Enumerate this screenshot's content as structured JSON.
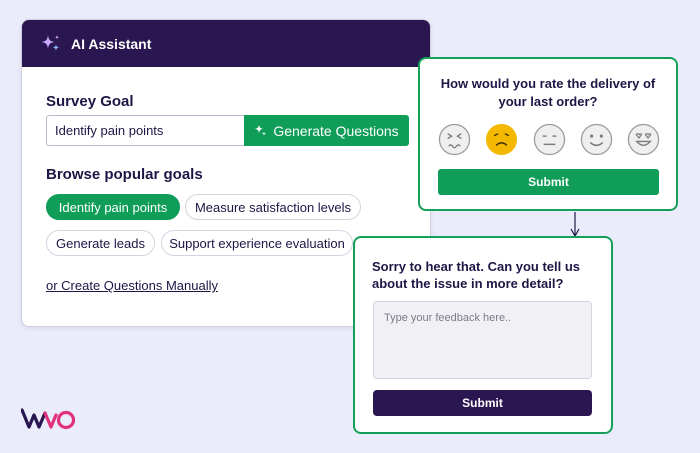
{
  "assistant": {
    "title": "AI Assistant",
    "survey_goal_label": "Survey Goal",
    "goal_value": "Identify pain points",
    "generate_label": "Generate Questions",
    "browse_label": "Browse popular goals",
    "chips": [
      "Identify pain points",
      "Measure satisfaction levels",
      "Generate leads",
      "Support experience evaluation"
    ],
    "manual_link": "or Create Questions Manually"
  },
  "rating": {
    "question": "How would you rate the delivery of your last order?",
    "faces": [
      "very-unhappy-face-icon",
      "unhappy-face-icon",
      "neutral-face-icon",
      "happy-face-icon",
      "very-happy-face-icon"
    ],
    "selected_face": "unhappy-face-icon",
    "submit_label": "Submit"
  },
  "feedback": {
    "question": "Sorry to hear that. Can you tell us about the issue in more detail?",
    "placeholder": "Type your feedback here..",
    "submit_label": "Submit"
  },
  "colors": {
    "brand_dark": "#2a1650",
    "accent_green": "#0f9d58",
    "selected_face": "#f5b800",
    "background": "#ebecfb",
    "logo_pink": "#e0317b"
  }
}
